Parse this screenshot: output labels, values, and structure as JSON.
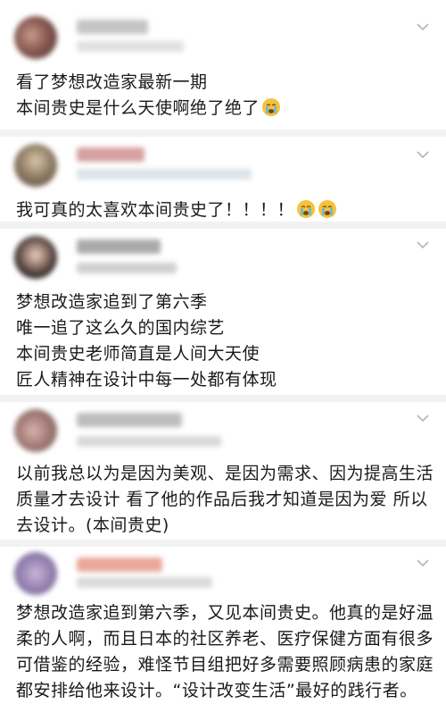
{
  "colors": {
    "separator": "#f2f2f2",
    "text": "#1a1a1a",
    "chevron": "#b5b5b5",
    "blur_name": "#c7c7c7",
    "blur_meta": "#dcdcdc"
  },
  "posts": [
    {
      "lines": [
        "看了梦想改造家最新一期",
        "本间贵史是什么天使啊绝了绝了"
      ],
      "emoji_after_last_line": [
        "crying-face-icon"
      ]
    },
    {
      "lines": [
        "我可真的太喜欢本间贵史了！！！！"
      ],
      "emoji_after_last_line": [
        "crying-face-icon",
        "crying-face-icon"
      ]
    },
    {
      "lines": [
        "梦想改造家追到了第六季",
        "唯一追了这么久的国内综艺",
        "本间贵史老师简直是人间大天使",
        "匠人精神在设计中每一处都有体现"
      ],
      "emoji_after_last_line": []
    },
    {
      "lines": [
        "以前我总以为是因为美观、是因为需求、因为提高生活",
        "质量才去设计 看了他的作品后我才知道是因为爱 所以",
        "去设计。(本间贵史)"
      ],
      "emoji_after_last_line": []
    },
    {
      "lines": [
        "梦想改造家追到第六季，又见本间贵史。他真的是好温",
        "柔的人啊，而且日本的社区养老、医疗保健方面有很多",
        "可借鉴的经验，难怪节目组把好多需要照顾病患的家庭",
        "都安排给他来设计。“设计改变生活”最好的践行者。"
      ],
      "emoji_after_last_line": []
    }
  ]
}
